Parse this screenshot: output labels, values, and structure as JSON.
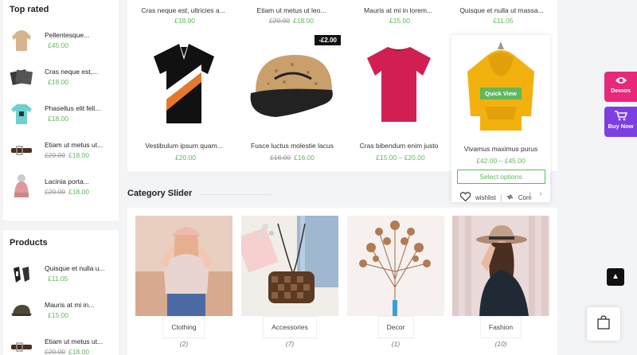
{
  "sidebar": {
    "top_rated_title": "Top rated",
    "top_rated": [
      {
        "name": "Pellentesque...",
        "price": "£45.00",
        "old": ""
      },
      {
        "name": "Cras neque est,...",
        "price": "£18.00",
        "old": ""
      },
      {
        "name": "Phasellus elit feli...",
        "price": "£18.00",
        "old": ""
      },
      {
        "name": "Etiam ut metus ut...",
        "price": "£18.00",
        "old": "£20.00"
      },
      {
        "name": "Lacinia porta...",
        "price": "£18.00",
        "old": "£20.00"
      }
    ],
    "products_title": "Products",
    "products": [
      {
        "name": "Quisque et nulla u...",
        "price": "£11.05",
        "old": ""
      },
      {
        "name": "Mauris at mi in...",
        "price": "£15.00",
        "old": ""
      },
      {
        "name": "Etiam ut metus ut...",
        "price": "£18.00",
        "old": "£20.00"
      }
    ]
  },
  "top_row": [
    {
      "name": "Cras neque est, ultricies a...",
      "price": "£18.00",
      "old": ""
    },
    {
      "name": "Etiam ut metus ut leo...",
      "price": "£18.00",
      "old": "£20.00"
    },
    {
      "name": "Mauris at mi in lorem...",
      "price": "£15.00",
      "old": ""
    },
    {
      "name": "Quisque et nulla ut massa...",
      "price": "£11.05",
      "old": ""
    }
  ],
  "products": [
    {
      "name": "Vestibulum ipsum quam...",
      "price": "£20.00",
      "old": "",
      "badge": ""
    },
    {
      "name": "Fusce luctus molestie lacus",
      "price": "£16.00",
      "old": "£18.00",
      "badge": "-£2.00"
    },
    {
      "name": "Cras bibendum enim justo",
      "price": "£15.00 – £20.00",
      "old": "",
      "badge": ""
    }
  ],
  "hover_product": {
    "name": "Vivamus maximus purus",
    "price": "£42.00 – £45.00",
    "quick_view": "Quick View",
    "select_options": "Select options",
    "wishlist": "wishlist",
    "compare": "Com"
  },
  "category_slider": {
    "title": "Category Slider",
    "items": [
      {
        "label": "Clothing",
        "count": "(2)"
      },
      {
        "label": "Accessories",
        "count": "(7)"
      },
      {
        "label": "Decor",
        "count": "(1)"
      },
      {
        "label": "Fashion",
        "count": "(10)"
      }
    ]
  },
  "floating": {
    "demos": "Demos",
    "buy_now": "Buy Now"
  },
  "colors": {
    "accent_green": "#5fb85c",
    "demo_pink": "#e8287b",
    "buy_purple": "#7b3fe4"
  },
  "icons": {
    "heart": "heart-icon",
    "compare": "compare-icon",
    "cart": "cart-icon",
    "eye": "eye-icon",
    "arrow_up": "arrow-up-icon",
    "bag": "shopping-bag-icon"
  }
}
